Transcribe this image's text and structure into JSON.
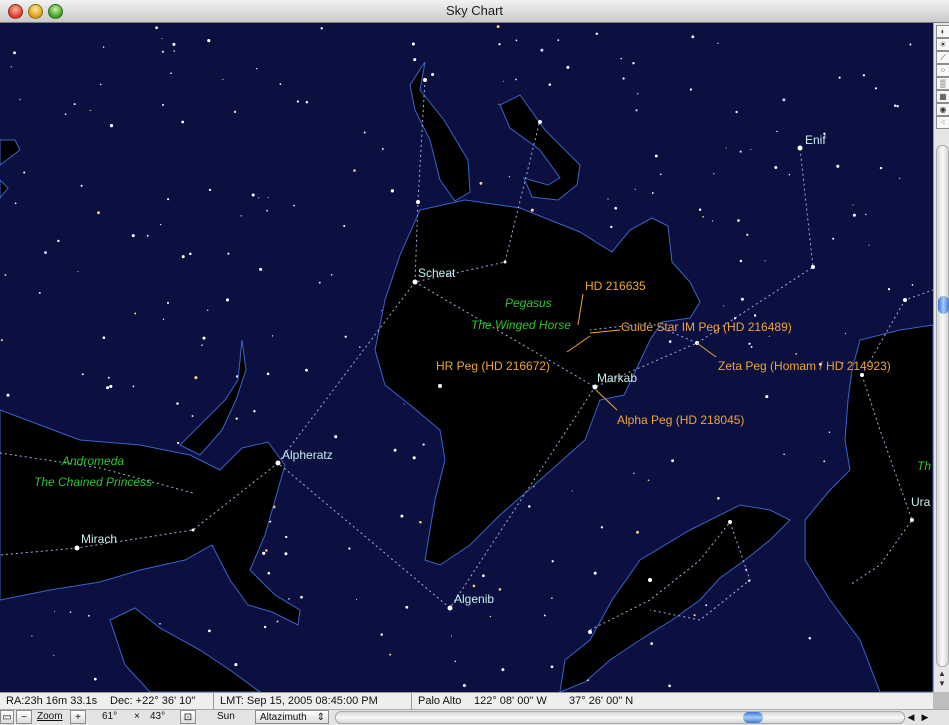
{
  "window": {
    "title": "Sky Chart"
  },
  "sky": {
    "colors": {
      "background": "#0b1040",
      "constellation_figure": "#000000",
      "figure_outline": "#3a63c8",
      "lines": "#9fb0e0",
      "star_label": "#c8f0ec",
      "constellation_label": "#2fc52f",
      "object_label": "#f0a43a"
    },
    "constellations": [
      {
        "name": "Pegasus",
        "subtitle": "The Winged Horse"
      },
      {
        "name": "Andromeda",
        "subtitle": "The Chained Princess"
      }
    ],
    "star_labels": [
      "Enif",
      "Scheat",
      "Markab",
      "Alpheratz",
      "Mirach",
      "Algenib",
      "Ura"
    ],
    "object_labels": [
      "HD 216635",
      "Guide Star IM Peg (HD 216489)",
      "HR Peg (HD 216672)",
      "Zeta Peg  (Homam / HD 214923)",
      "Alpha Peg (HD 218045)"
    ],
    "partial_label": "Th"
  },
  "sidebar": {
    "tools": [
      "moon-tool-icon",
      "sun-tool-icon",
      "telescope-tool-icon",
      "grid-dots-tool-icon",
      "gradient-tool-icon",
      "grid-tool-icon",
      "planet-tool-icon",
      "zoom-dots-tool-icon"
    ]
  },
  "status": {
    "ra": "RA:23h 16m 33.1s",
    "dec": "Dec: +22° 36' 10\"",
    "lmt": "LMT:  Sep 15, 2005     08:45:00 PM",
    "location": "Palo Alto",
    "longitude": "122° 08' 00\" W",
    "latitude": "37° 26' 00\" N"
  },
  "controls": {
    "zoom_label": "Zoom",
    "fov_width": "61°",
    "fov_x": "×",
    "fov_height": "43°",
    "target": "Sun",
    "view_mode": "Altazimuth"
  }
}
